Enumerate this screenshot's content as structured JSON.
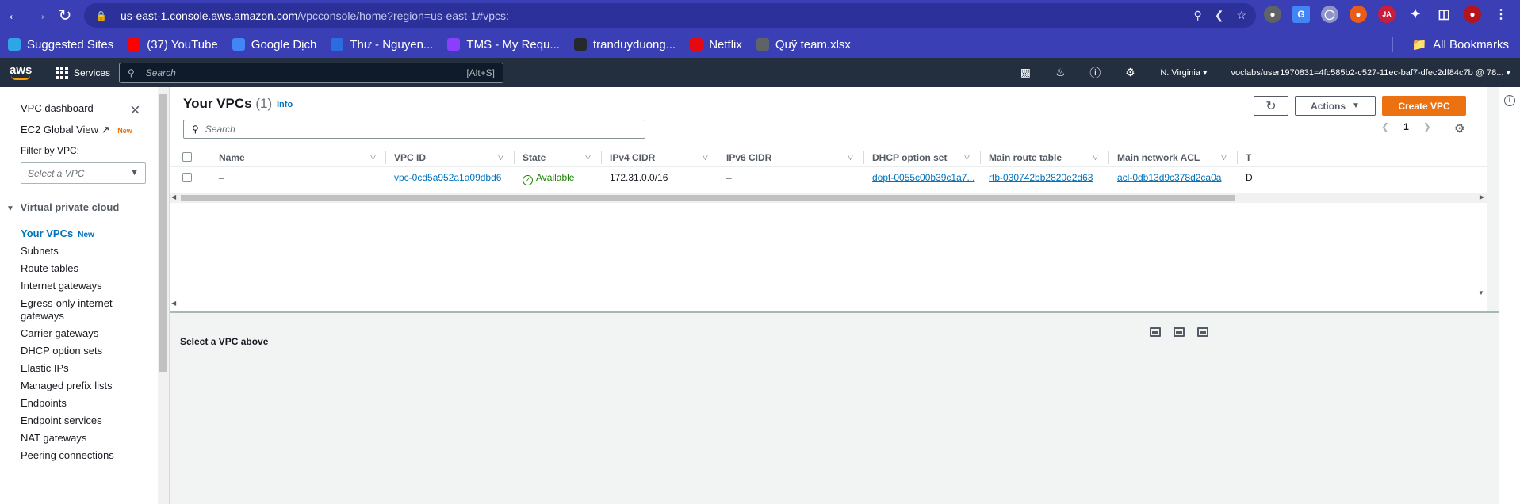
{
  "browser": {
    "url_host": "us-east-1.console.aws.amazon.com",
    "url_path": "/vpcconsole/home?region=us-east-1#vpcs:",
    "bookmarks": [
      {
        "label": "Suggested Sites",
        "icon": "edge-icon",
        "color": "#2fa4e7"
      },
      {
        "label": "(37) YouTube",
        "icon": "youtube-icon",
        "color": "#ff0000"
      },
      {
        "label": "Google Dịch",
        "icon": "translate-icon",
        "color": "#4285f4"
      },
      {
        "label": "Thư - Nguyen...",
        "icon": "mail-icon",
        "color": "#2b6cdf"
      },
      {
        "label": "TMS - My Requ...",
        "icon": "tms-icon",
        "color": "#8a3ffc"
      },
      {
        "label": "tranduyduong...",
        "icon": "github-icon",
        "color": "#24292e"
      },
      {
        "label": "Netflix",
        "icon": "netflix-icon",
        "color": "#e50914"
      },
      {
        "label": "Quỹ team.xlsx",
        "icon": "globe-icon",
        "color": "#5f6368"
      }
    ],
    "all_bookmarks": "All Bookmarks"
  },
  "aws_nav": {
    "services": "Services",
    "search_placeholder": "Search",
    "search_hint": "[Alt+S]",
    "region": "N. Virginia ▾",
    "account": "voclabs/user1970831=4fc585b2-c527-11ec-baf7-dfec2df84c7b @ 78... ▾"
  },
  "sidebar": {
    "dashboard": "VPC dashboard",
    "ec2_global_view": "EC2 Global View",
    "ec2_new": "New",
    "filter_label": "Filter by VPC:",
    "filter_placeholder": "Select a VPC",
    "section": "Virtual private cloud",
    "items": [
      {
        "label": "Your VPCs",
        "badge": "New",
        "active": true
      },
      {
        "label": "Subnets"
      },
      {
        "label": "Route tables"
      },
      {
        "label": "Internet gateways"
      },
      {
        "label": "Egress-only internet"
      },
      {
        "label": "gateways"
      },
      {
        "label": "Carrier gateways"
      },
      {
        "label": "DHCP option sets"
      },
      {
        "label": "Elastic IPs"
      },
      {
        "label": "Managed prefix lists"
      },
      {
        "label": "Endpoints"
      },
      {
        "label": "Endpoint services"
      },
      {
        "label": "NAT gateways"
      },
      {
        "label": "Peering connections"
      }
    ]
  },
  "main": {
    "title": "Your VPCs",
    "count": "(1)",
    "info": "Info",
    "actions": "Actions",
    "create": "Create VPC",
    "search_placeholder": "Search",
    "page": "1",
    "columns": [
      "Name",
      "VPC ID",
      "State",
      "IPv4 CIDR",
      "IPv6 CIDR",
      "DHCP option set",
      "Main route table",
      "Main network ACL",
      "T"
    ],
    "rows": [
      {
        "name": "–",
        "vpc_id": "vpc-0cd5a952a1a09dbd6",
        "state": "Available",
        "ipv4": "172.31.0.0/16",
        "ipv6": "–",
        "dhcp": "dopt-0055c00b39c1a7...",
        "route_table": "rtb-030742bb2820e2d63",
        "acl": "acl-0db13d9c378d2ca0a",
        "t": "D"
      }
    ],
    "detail_message": "Select a VPC above"
  },
  "colors": {
    "accent": "#0073bb",
    "primary_button": "#ec7211",
    "success": "#1d8102",
    "aws_nav": "#232f3e",
    "browser_chrome": "#3a3fb5"
  }
}
